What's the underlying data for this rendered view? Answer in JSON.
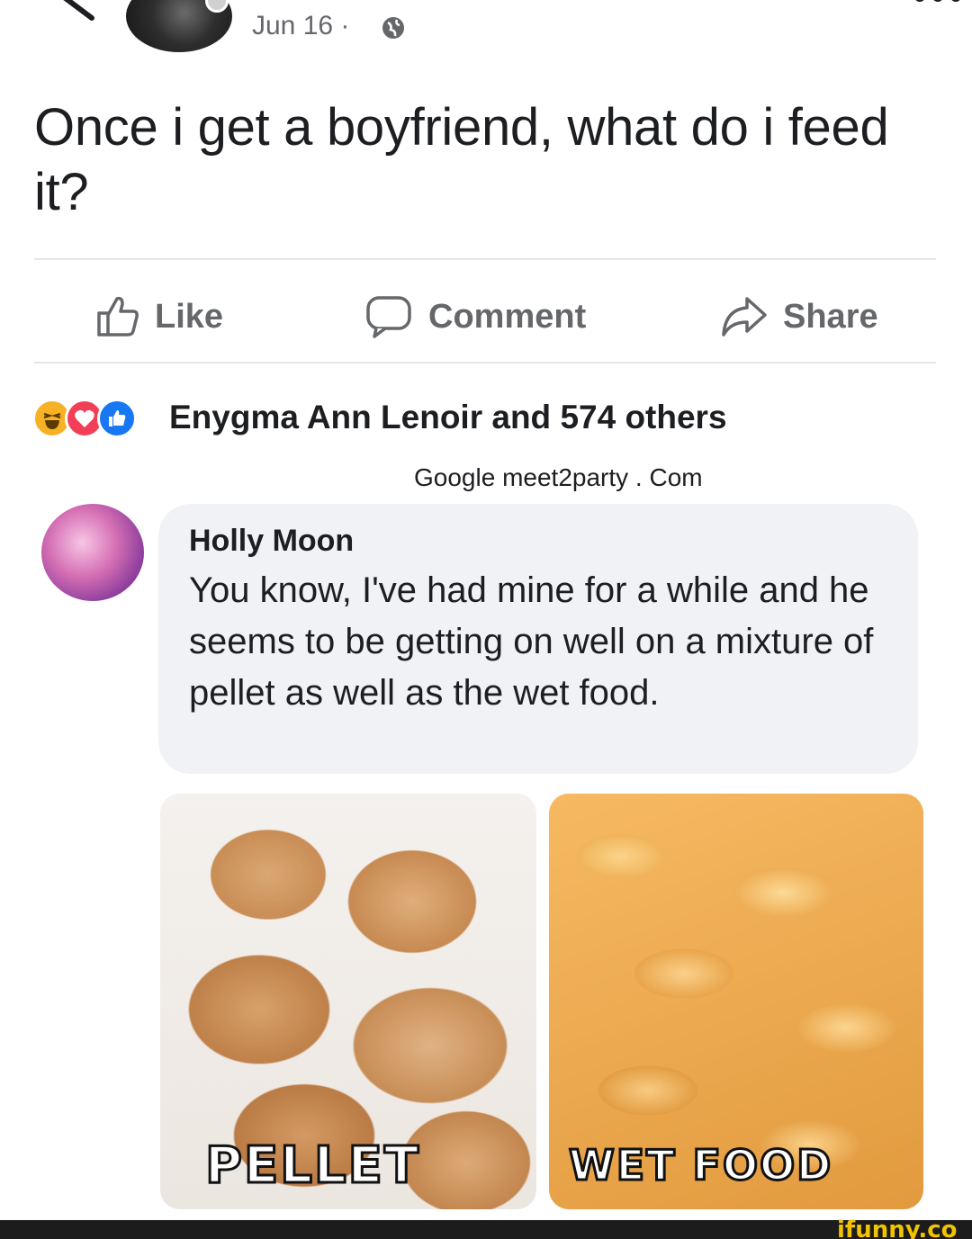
{
  "post": {
    "date": "Jun 16 ·",
    "text": "Once i get a boyfriend, what do i feed it?"
  },
  "actions": {
    "like_label": "Like",
    "comment_label": "Comment",
    "share_label": "Share"
  },
  "reactions": {
    "icons": [
      "haha-icon",
      "love-icon",
      "like-icon"
    ],
    "summary": "Enygma Ann Lenoir and 574 others"
  },
  "ad_overlay": "Google meet2party . Com",
  "comment": {
    "author": "Holly Moon",
    "text": "You know, I've had mine for a while and he seems to be getting on well on a mixture of pellet as well as the wet food."
  },
  "photos": {
    "left_label": "PELLET",
    "right_label": "WET FOOD"
  },
  "watermark": "ifunny.co",
  "colors": {
    "secondary_text": "#65676b",
    "bubble_bg": "#f0f2f5",
    "divider": "#e4e6eb",
    "like_blue": "#1877f2",
    "love_red": "#f33e58",
    "haha_yellow": "#f7b125",
    "watermark_yellow": "#f2c300"
  }
}
